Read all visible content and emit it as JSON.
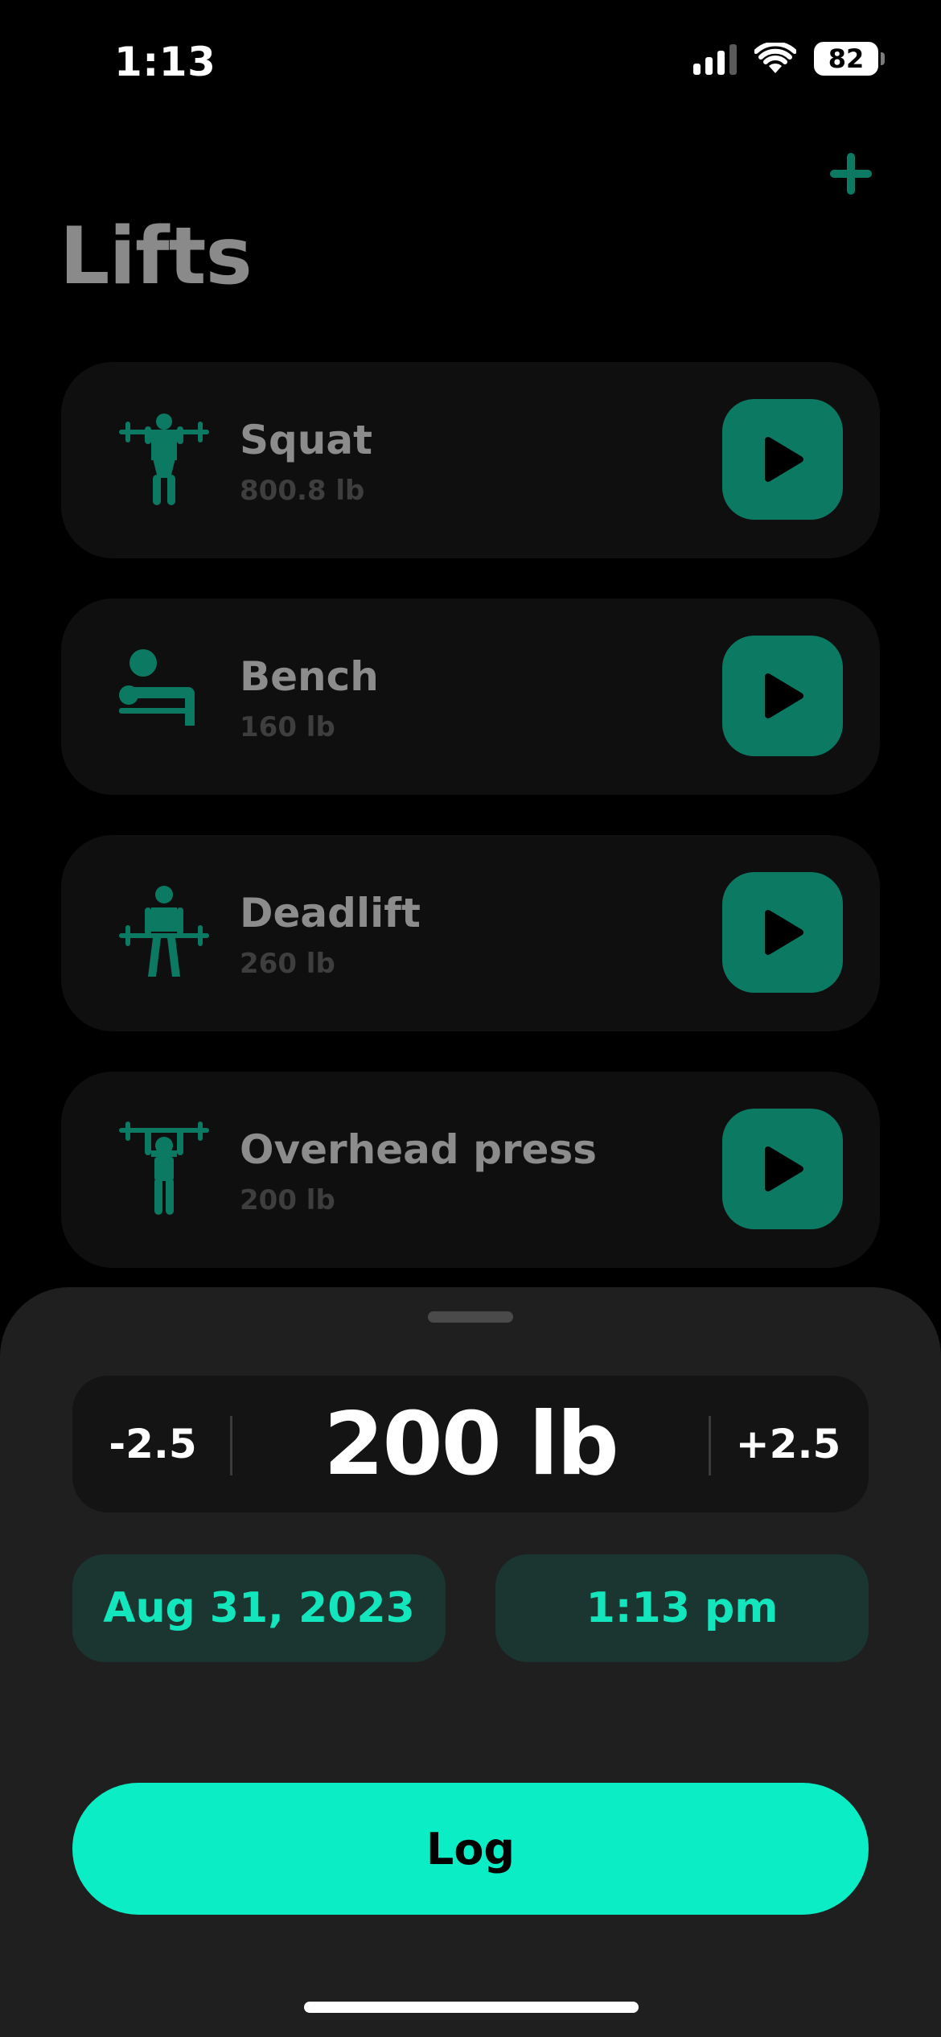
{
  "status_bar": {
    "time": "1:13",
    "battery": "82",
    "signal_icon": "cellular-signal-icon",
    "wifi_icon": "wifi-icon"
  },
  "header": {
    "title": "Lifts",
    "add_icon": "plus-icon"
  },
  "colors": {
    "accent": "#0bedc4",
    "accent_dark": "#0c7a63",
    "pill_bg": "#1b3630",
    "card_bg": "#0f0f0f",
    "sheet_bg": "#1f1f1f"
  },
  "lifts": [
    {
      "name": "Squat",
      "weight": "800.8 lb",
      "icon": "squat-icon"
    },
    {
      "name": "Bench",
      "weight": "160 lb",
      "icon": "bench-press-icon"
    },
    {
      "name": "Deadlift",
      "weight": "260 lb",
      "icon": "deadlift-icon"
    },
    {
      "name": "Overhead press",
      "weight": "200 lb",
      "icon": "overhead-press-icon"
    }
  ],
  "logger": {
    "decrement": "-2.5",
    "increment": "+2.5",
    "weight": "200 lb",
    "date": "Aug 31, 2023",
    "time": "1:13 pm",
    "log_label": "Log"
  }
}
